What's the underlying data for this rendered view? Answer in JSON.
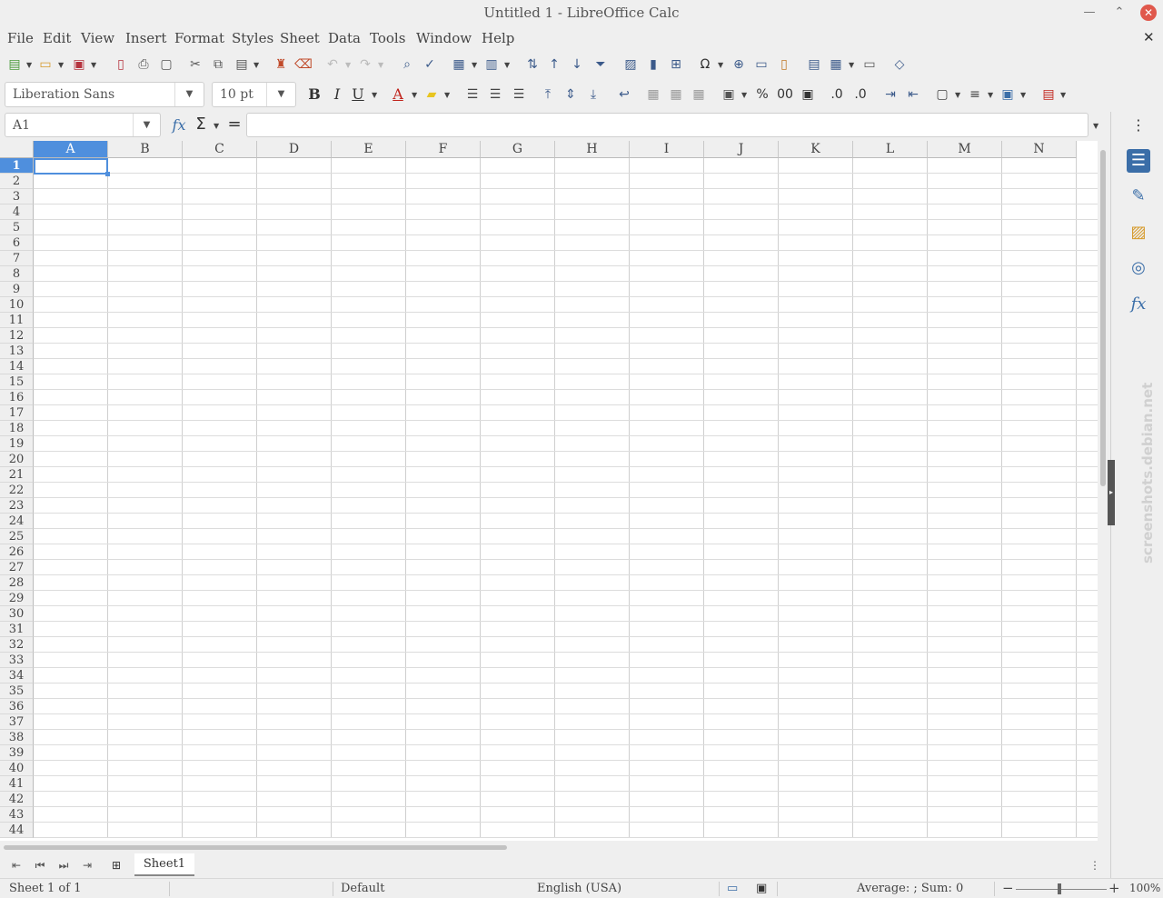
{
  "window": {
    "title": "Untitled 1 - LibreOffice Calc",
    "minimize_icon": "minimize-icon",
    "restore_icon": "restore-icon",
    "close_icon": "close-icon",
    "close_color": "#e0584c"
  },
  "menubar": {
    "items": [
      "File",
      "Edit",
      "View",
      "Insert",
      "Format",
      "Styles",
      "Sheet",
      "Data",
      "Tools",
      "Window",
      "Help"
    ],
    "doc_close_glyph": "✕"
  },
  "toolbar": {
    "font_name": "Liberation Sans",
    "font_size": "10 pt",
    "bold_label": "B",
    "italic_label": "I",
    "underline_label": "U",
    "font_color_label": "A",
    "percent_label": "%",
    "accent_color": "#3b5a8a"
  },
  "formula_bar": {
    "name_box_value": "A1",
    "function_wizard_label": "fx",
    "sum_label": "Σ",
    "equals_label": "=",
    "input_value": ""
  },
  "sheet": {
    "columns": [
      "A",
      "B",
      "C",
      "D",
      "E",
      "F",
      "G",
      "H",
      "I",
      "J",
      "K",
      "L",
      "M",
      "N"
    ],
    "rows": [
      "1",
      "2",
      "3",
      "4",
      "5",
      "6",
      "7",
      "8",
      "9",
      "10",
      "11",
      "12",
      "13",
      "14",
      "15",
      "16",
      "17",
      "18",
      "19",
      "20",
      "21",
      "22",
      "23",
      "24",
      "25",
      "26",
      "27",
      "28",
      "29",
      "30",
      "31",
      "32",
      "33",
      "34",
      "35",
      "36",
      "37",
      "38",
      "39",
      "40",
      "41",
      "42",
      "43",
      "44"
    ],
    "selected_cell": "A1",
    "selection_color": "#4f8fdd"
  },
  "tabs": {
    "sheet_tab_label": "Sheet1"
  },
  "statusbar": {
    "sheet_position": "Sheet 1 of 1",
    "page_style": "Default",
    "language": "English (USA)",
    "aggregate": "Average: ; Sum: 0",
    "zoom_level": "100%",
    "zoom_minus": "−",
    "zoom_plus": "+"
  },
  "sidebar": {
    "icons": [
      "properties-icon",
      "styles-icon",
      "gallery-icon",
      "navigator-icon",
      "functions-icon"
    ],
    "functions_label": "fx"
  },
  "watermark": "screenshots.debian.net"
}
